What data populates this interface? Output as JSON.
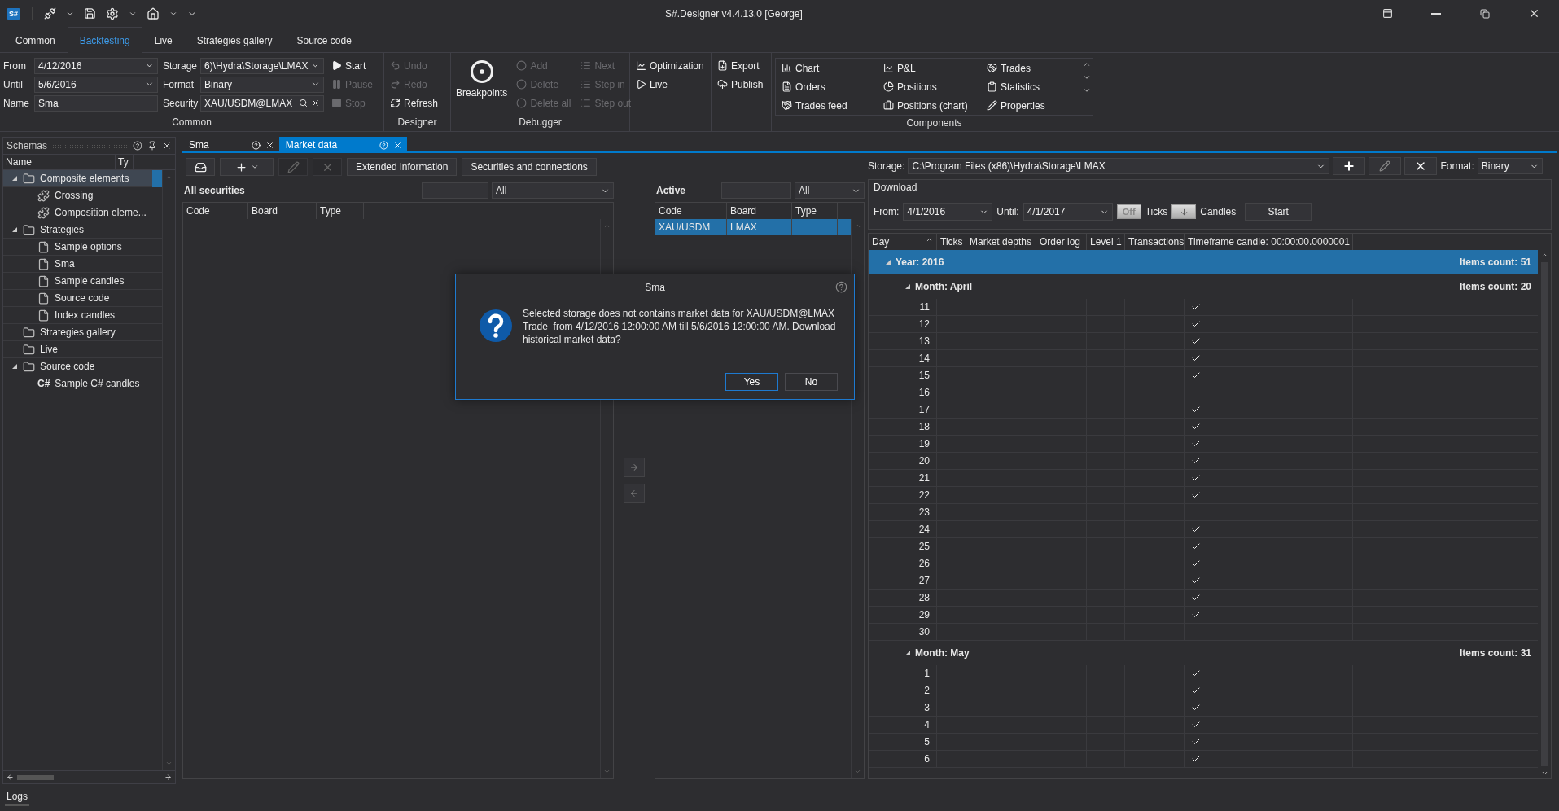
{
  "window": {
    "title": "S#.Designer v4.4.13.0 [George]",
    "logo": "S#"
  },
  "ribbon_tabs": [
    {
      "label": "Common",
      "selected": false
    },
    {
      "label": "Backtesting",
      "selected": true
    },
    {
      "label": "Live",
      "selected": false
    },
    {
      "label": "Strategies gallery",
      "selected": false
    },
    {
      "label": "Source code",
      "selected": false
    }
  ],
  "common_group": {
    "title": "Common",
    "fields": [
      {
        "label": "From",
        "value": "4/12/2016",
        "kind": "dropdown"
      },
      {
        "label": "Until",
        "value": "5/6/2016",
        "kind": "dropdown"
      },
      {
        "label": "Name",
        "value": "Sma",
        "kind": "text"
      }
    ],
    "fields_2": [
      {
        "label": "Storage",
        "value": "6)\\Hydra\\Storage\\LMAX",
        "kind": "dropdown"
      },
      {
        "label": "Format",
        "value": "Binary",
        "kind": "dropdown"
      },
      {
        "label": "Security",
        "value": "XAU/USDM@LMAX",
        "kind": "search"
      }
    ],
    "run_buttons": [
      {
        "label": "Start",
        "disabled": false
      },
      {
        "label": "Pause",
        "disabled": true
      },
      {
        "label": "Stop",
        "disabled": true
      }
    ]
  },
  "designer_group": {
    "title": "Designer",
    "buttons": [
      {
        "label": "Undo",
        "disabled": true
      },
      {
        "label": "Redo",
        "disabled": true
      },
      {
        "label": "Refresh",
        "disabled": false
      }
    ]
  },
  "debugger_group": {
    "title": "Debugger",
    "breakpoints": "Breakpoints",
    "buttons": [
      {
        "label": "Add",
        "disabled": true
      },
      {
        "label": "Delete",
        "disabled": true
      },
      {
        "label": "Delete all",
        "disabled": true
      },
      {
        "label": "Next",
        "disabled": true
      },
      {
        "label": "Step in",
        "disabled": true
      },
      {
        "label": "Step out",
        "disabled": true
      }
    ]
  },
  "run_group": {
    "buttons": [
      {
        "label": "Optimization"
      },
      {
        "label": "Live"
      }
    ]
  },
  "publish_group": {
    "buttons": [
      {
        "label": "Export"
      },
      {
        "label": "Publish"
      }
    ]
  },
  "components_group": {
    "title": "Components",
    "items": [
      "Chart",
      "P&L",
      "Trades",
      "Orders",
      "Positions",
      "Statistics",
      "Trades feed",
      "Positions (chart)",
      "Properties"
    ]
  },
  "schemas": {
    "title": "Schemas",
    "columns": [
      "Name",
      "Ty"
    ],
    "tree": [
      {
        "label": "Composite elements",
        "kind": "folder",
        "selected": true,
        "expanded": true,
        "children": [
          {
            "label": "Crossing",
            "kind": "composite",
            "selected": false
          },
          {
            "label": "Composition eleme...",
            "kind": "composite",
            "selected": false
          }
        ]
      },
      {
        "label": "Strategies",
        "kind": "folder",
        "selected": false,
        "expanded": true,
        "children": [
          {
            "label": "Sample options",
            "kind": "document",
            "selected": false
          },
          {
            "label": "Sma",
            "kind": "document",
            "selected": false
          },
          {
            "label": "Sample candles",
            "kind": "document",
            "selected": false
          },
          {
            "label": "Source code",
            "kind": "document",
            "selected": false
          },
          {
            "label": "Index candles",
            "kind": "document",
            "selected": false
          }
        ]
      },
      {
        "label": "Strategies gallery",
        "kind": "folder",
        "selected": false
      },
      {
        "label": "Live",
        "kind": "folder",
        "selected": false
      },
      {
        "label": "Source code",
        "kind": "folder",
        "selected": false,
        "expanded": true,
        "children": [
          {
            "label": "Sample C# candles",
            "kind": "code",
            "icon_text": "C#",
            "selected": false
          }
        ]
      }
    ]
  },
  "doc_tabs": [
    {
      "label": "Sma",
      "selected": false
    },
    {
      "label": "Market data",
      "selected": true
    }
  ],
  "toolbar": {
    "buttons": [
      {
        "kind": "import",
        "disabled": false
      },
      {
        "kind": "add",
        "disabled": false
      },
      {
        "kind": "edit",
        "disabled": true
      },
      {
        "kind": "delete",
        "disabled": true
      }
    ],
    "text_buttons": [
      "Extended information",
      "Securities and connections"
    ]
  },
  "all_securities": {
    "title": "All securities",
    "filter": "All",
    "columns": [
      "Code",
      "Board",
      "Type"
    ]
  },
  "active": {
    "title": "Active",
    "filter": "All",
    "columns": [
      "Code",
      "Board",
      "Type"
    ],
    "rows": [
      {
        "code": "XAU/USDM",
        "board": "LMAX",
        "selected": true
      }
    ]
  },
  "storage": {
    "label": "Storage:",
    "value": "C:\\Program Files (x86)\\Hydra\\Storage\\LMAX",
    "format_label": "Format:",
    "format": "Binary"
  },
  "download": {
    "title": "Download",
    "from_label": "From:",
    "from": "4/1/2016",
    "until_label": "Until:",
    "until": "4/1/2017",
    "ticks": {
      "text": "Off",
      "label": "Ticks",
      "on": false
    },
    "candles_label": "Candles",
    "start": "Start"
  },
  "grid": {
    "columns": [
      "Day",
      "Ticks",
      "Market depths",
      "Order log",
      "Level 1",
      "Transactions",
      "Timeframe candle: 00:00:00.0000001"
    ],
    "groups": [
      {
        "label": "Year: 2016",
        "count": "Items count: 51",
        "selected": true,
        "expanded": true,
        "children": [
          {
            "label": "Month: April",
            "count": "Items count: 20",
            "expanded": true,
            "days": [
              {
                "day": "11",
                "candle": true
              },
              {
                "day": "12",
                "candle": true
              },
              {
                "day": "13",
                "candle": true
              },
              {
                "day": "14",
                "candle": true
              },
              {
                "day": "15",
                "candle": true
              },
              {
                "day": "16",
                "candle": false
              },
              {
                "day": "17",
                "candle": true
              },
              {
                "day": "18",
                "candle": true
              },
              {
                "day": "19",
                "candle": true
              },
              {
                "day": "20",
                "candle": true
              },
              {
                "day": "21",
                "candle": true
              },
              {
                "day": "22",
                "candle": true
              },
              {
                "day": "23",
                "candle": false
              },
              {
                "day": "24",
                "candle": true
              },
              {
                "day": "25",
                "candle": true
              },
              {
                "day": "26",
                "candle": true
              },
              {
                "day": "27",
                "candle": true
              },
              {
                "day": "28",
                "candle": true
              },
              {
                "day": "29",
                "candle": true
              },
              {
                "day": "30",
                "candle": false
              }
            ]
          },
          {
            "label": "Month: May",
            "count": "Items count: 31",
            "expanded": true,
            "days": [
              {
                "day": "1",
                "candle": true
              },
              {
                "day": "2",
                "candle": true
              },
              {
                "day": "3",
                "candle": true
              },
              {
                "day": "4",
                "candle": true
              },
              {
                "day": "5",
                "candle": true
              },
              {
                "day": "6",
                "candle": true
              }
            ]
          }
        ]
      }
    ]
  },
  "dialog": {
    "title": "Sma",
    "message": "Selected storage does not contains market data for XAU/USDM@LMAX Trade  from 4/12/2016 12:00:00 AM till 5/6/2016 12:00:00 AM. Download historical market data?",
    "buttons": [
      {
        "label": "Yes",
        "selected": true
      },
      {
        "label": "No",
        "selected": false
      }
    ]
  },
  "bottom_tabs": [
    "Logs"
  ]
}
